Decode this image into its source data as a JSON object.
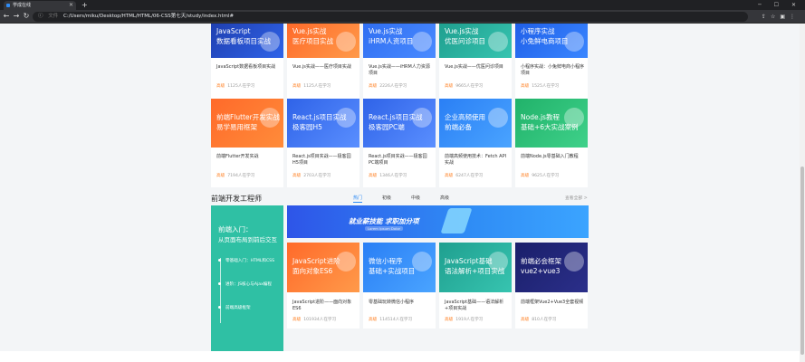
{
  "browser": {
    "tab_title": "学成在线",
    "address_label": "文件",
    "address": "C:/Users/miku/Desktop/HTML/HTML/06-CSS第七天/study/index.html#"
  },
  "cards": [
    {
      "id": "c1",
      "color1": "#1f3fb0",
      "color2": "#2f63e8",
      "thumb_lines": [
        "JavaScript",
        "数据看板项目实战"
      ],
      "title": "JavaScript数据看板项目实战",
      "level": "高级",
      "students": "1125人在学习"
    },
    {
      "id": "c2",
      "color1": "#ff6a2a",
      "color2": "#ff9a4a",
      "thumb_lines": [
        "Vue.js实战",
        "医疗项目实战"
      ],
      "title": "Vue.js实战——医疗项目实战",
      "level": "高级",
      "students": "1125人在学习"
    },
    {
      "id": "c3",
      "color1": "#2f6ef2",
      "color2": "#4a8bff",
      "thumb_lines": [
        "Vue.js实战",
        "iHRM人资项目"
      ],
      "title": "Vue.js实战——iHRM人力资源项目",
      "level": "高级",
      "students": "2226人在学习"
    },
    {
      "id": "c4",
      "color1": "#1f9f8f",
      "color2": "#37c4b0",
      "thumb_lines": [
        "Vue.js实战",
        "优医问诊项目"
      ],
      "title": "Vue.js实战——优医问诊项目",
      "level": "高级",
      "students": "9665人在学习"
    },
    {
      "id": "c5",
      "color1": "#1f5fe8",
      "color2": "#3a86ff",
      "thumb_lines": [
        "小程序实战",
        "小兔鲜电商项目"
      ],
      "title": "小程序实战：小兔鲜电商小程序项目",
      "level": "高级",
      "students": "1525人在学习"
    },
    {
      "id": "c6",
      "color1": "#ff6a2a",
      "color2": "#ff8c3a",
      "thumb_lines": [
        "前端Flutter开发实战",
        "易学易用框架"
      ],
      "title": "前端Flutter开发实战",
      "level": "高级",
      "students": "7194人在学习"
    },
    {
      "id": "c7",
      "color1": "#2f63e8",
      "color2": "#5a8fff",
      "thumb_lines": [
        "React.js项目实战",
        "极客园H5"
      ],
      "title": "React.js项目实战——极客园H5项目",
      "level": "高级",
      "students": "2703人在学习"
    },
    {
      "id": "c8",
      "color1": "#2f63e8",
      "color2": "#5a8fff",
      "thumb_lines": [
        "React.js项目实战",
        "极客园PC端"
      ],
      "title": "React.js项目实战——极客园PC端项目",
      "level": "高级",
      "students": "1346人在学习"
    },
    {
      "id": "c9",
      "color1": "#2a7ff5",
      "color2": "#4aa4ff",
      "thumb_lines": [
        "企业高频使用",
        "前端必备"
      ],
      "title": "前端高频使用技术：Fetch API实战",
      "level": "高级",
      "students": "6247人在学习"
    },
    {
      "id": "c10",
      "color1": "#21b26a",
      "color2": "#3fd18a",
      "thumb_lines": [
        "Node.js教程",
        "基础+6大实战案例"
      ],
      "title": "前端Node.js零基础入门教程",
      "level": "高级",
      "students": "9625人在学习"
    },
    {
      "id": "c11",
      "color1": "#ff6a2a",
      "color2": "#ff9a4a",
      "thumb_lines": [
        "JavaScript进阶",
        "面向对象ES6"
      ],
      "title": "JavaScript进阶——面向对象ES6",
      "level": "高级",
      "students": "101934人在学习"
    },
    {
      "id": "c12",
      "color1": "#2a7ff5",
      "color2": "#4aa4ff",
      "thumb_lines": [
        "微信小程序",
        "基础+实战项目"
      ],
      "title": "零基础玩转微信小程序",
      "level": "高级",
      "students": "114514人在学习"
    },
    {
      "id": "c13",
      "color1": "#1f9f8f",
      "color2": "#37c4b0",
      "thumb_lines": [
        "JavaScript基础",
        "语法解析+项目实战"
      ],
      "title": "JavaScript基础——语法解析+项目实战",
      "level": "高级",
      "students": "1919人在学习"
    },
    {
      "id": "c14",
      "color1": "#1a1f6a",
      "color2": "#2b2f8a",
      "thumb_lines": [
        "前端必会框架",
        "vue2+vue3"
      ],
      "title": "前端框架Vue2+Vue3全套视频",
      "level": "高级",
      "students": "810人在学习"
    }
  ],
  "section": {
    "title": "前端开发工程师",
    "tabs": [
      "热门",
      "初级",
      "中级",
      "高级"
    ],
    "see_all": "查看全部 >"
  },
  "path": {
    "heading1": "前端入门：",
    "heading2": "从页面布局到前后交互",
    "steps": [
      "零基础入门：HTML和CSS",
      "进阶：JS核心与Ajax编程",
      "前端高级框架"
    ]
  },
  "banner": {
    "title": "就业薪技能 求职加分项",
    "subtitle": "Lorem Ipsum Dolor"
  }
}
